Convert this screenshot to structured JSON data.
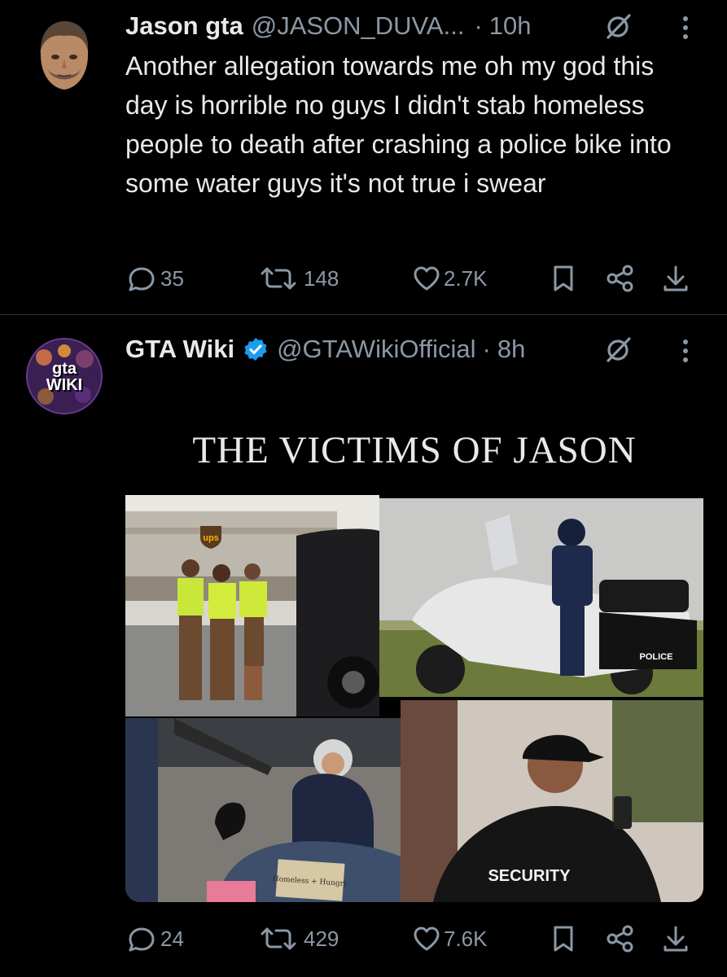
{
  "tweets": [
    {
      "author_name": "Jason gta",
      "handle": "@JASON_DUVA...",
      "separator": "·",
      "time": "10h",
      "text": "Another allegation towards me oh my god this day is horrible no guys I didn't stab homeless people to death after crashing a police bike into some water guys it's not true i swear",
      "stats": {
        "replies": "35",
        "reposts": "148",
        "likes": "2.7K"
      }
    },
    {
      "author_name": "GTA Wiki",
      "handle": "@GTAWikiOfficial",
      "separator": "·",
      "time": "8h",
      "avatar_text": "gta WIKI",
      "media": {
        "title": "THE VICTIMS OF JASON",
        "photos": [
          {
            "name": "ups-workers-photo",
            "sign_text": "ups"
          },
          {
            "name": "police-motorcycle-photo",
            "badge_text": "POLICE"
          },
          {
            "name": "homeless-person-photo",
            "sign_text": "Homeless + Hungry"
          },
          {
            "name": "security-guard-photo",
            "badge_text": "SECURITY"
          }
        ]
      },
      "stats": {
        "replies": "24",
        "reposts": "429",
        "likes": "7.6K"
      }
    }
  ],
  "colors": {
    "background": "#000000",
    "text": "#e7e9ea",
    "muted": "#8b98a5",
    "divider": "#2f3336",
    "verified": "#1d9bf0"
  },
  "icons": [
    "reply-icon",
    "repost-icon",
    "like-icon",
    "bookmark-icon",
    "share-icon",
    "download-icon",
    "grok-icon",
    "more-icon",
    "verified-badge-icon"
  ]
}
